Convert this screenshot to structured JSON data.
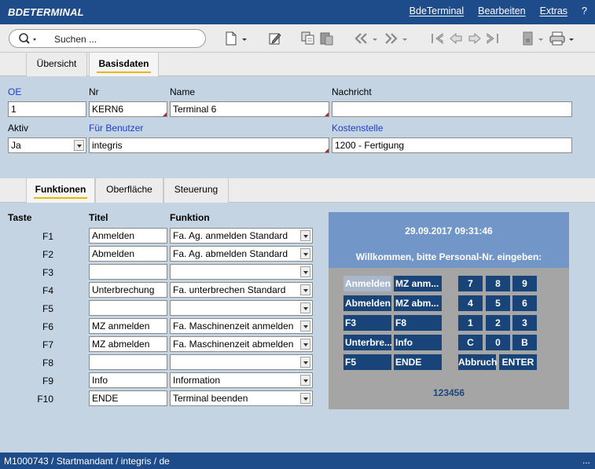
{
  "app_title": "BDETERMINAL",
  "menu": [
    "BdeTerminal",
    "Bearbeiten",
    "Extras",
    "?"
  ],
  "toolbar": {
    "search_placeholder": "Suchen ...",
    "icons": [
      "search-icon",
      "new-document-icon",
      "edit-icon",
      "copy-icon",
      "paste-icon",
      "back-double-icon",
      "forward-double-icon",
      "first-icon",
      "previous-icon",
      "next-icon",
      "last-icon",
      "export-icon",
      "print-icon"
    ]
  },
  "main_tabs": [
    {
      "label": "Übersicht",
      "active": false
    },
    {
      "label": "Basisdaten",
      "active": true
    }
  ],
  "form": {
    "oe_label": "OE",
    "oe_value": "1",
    "nr_label": "Nr",
    "nr_value": "KERN6",
    "name_label": "Name",
    "name_value": "Terminal 6",
    "nachricht_label": "Nachricht",
    "nachricht_value": "",
    "aktiv_label": "Aktiv",
    "aktiv_value": "Ja",
    "benutzer_label": "Für Benutzer",
    "benutzer_value": "integris",
    "kostenstelle_label": "Kostenstelle",
    "kostenstelle_value": "1200 - Fertigung"
  },
  "sub_tabs": [
    {
      "label": "Funktionen",
      "active": true
    },
    {
      "label": "Oberfläche",
      "active": false
    },
    {
      "label": "Steuerung",
      "active": false
    }
  ],
  "keys_table": {
    "headers": {
      "taste": "Taste",
      "titel": "Titel",
      "funktion": "Funktion"
    },
    "rows": [
      {
        "key": "F1",
        "title": "Anmelden",
        "function": "Fa. Ag. anmelden Standard"
      },
      {
        "key": "F2",
        "title": "Abmelden",
        "function": "Fa. Ag. abmelden Standard"
      },
      {
        "key": "F3",
        "title": "",
        "function": ""
      },
      {
        "key": "F4",
        "title": "Unterbrechung",
        "function": "Fa. unterbrechen Standard"
      },
      {
        "key": "F5",
        "title": "",
        "function": ""
      },
      {
        "key": "F6",
        "title": "MZ anmelden",
        "function": "Fa. Maschinenzeit anmelden"
      },
      {
        "key": "F7",
        "title": "MZ abmelden",
        "function": "Fa. Maschinenzeit abmelden"
      },
      {
        "key": "F8",
        "title": "",
        "function": ""
      },
      {
        "key": "F9",
        "title": "Info",
        "function": "Information"
      },
      {
        "key": "F10",
        "title": "ENDE",
        "function": "Terminal beenden"
      }
    ]
  },
  "terminal": {
    "datetime": "29.09.2017 09:31:46",
    "message": "Willkommen, bitte Personal-Nr. eingeben:",
    "left_buttons": [
      "Anmelden",
      "Abmelden",
      "F3",
      "Unterbre...",
      "F5"
    ],
    "right_buttons": [
      "MZ anm...",
      "MZ abm...",
      "F8",
      "Info",
      "ENDE"
    ],
    "keypad": [
      "7",
      "8",
      "9",
      "4",
      "5",
      "6",
      "1",
      "2",
      "3",
      "C",
      "0",
      "B"
    ],
    "abbruch": "Abbruch",
    "enter": "ENTER",
    "input_value": "123456"
  },
  "status": {
    "text": "M1000743 / Startmandant / integris / de",
    "dots": "..."
  },
  "colors": {
    "title_bar": "#1e4b8a",
    "background": "#c5d4e3",
    "terminal_header": "#7196c7",
    "terminal_button": "#184479",
    "terminal_panel": "#a5a5a5"
  }
}
